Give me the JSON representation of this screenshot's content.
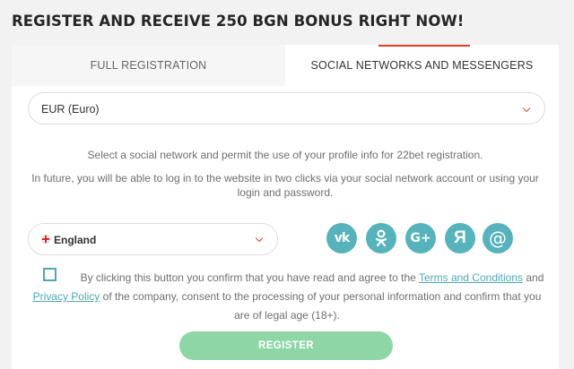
{
  "heading": "REGISTER AND RECEIVE 250 BGN BONUS RIGHT NOW!",
  "tabs": [
    {
      "label": "FULL REGISTRATION"
    },
    {
      "label": "SOCIAL NETWORKS AND MESSENGERS"
    }
  ],
  "active_tab": 1,
  "currency": {
    "value": "EUR (Euro)"
  },
  "info": {
    "line1": "Select a social network and permit the use of your profile info for 22bet registration.",
    "line2": "In future, you will be able to log in to the website in two clicks via your social network account or using your login and password."
  },
  "country": {
    "value": "England"
  },
  "social": [
    {
      "icon": "vk-icon",
      "glyph": "vk"
    },
    {
      "icon": "odnoklassniki-icon",
      "glyph": "ok"
    },
    {
      "icon": "google-plus-icon",
      "glyph": "G+"
    },
    {
      "icon": "yandex-icon",
      "glyph": "Я"
    },
    {
      "icon": "mail-at-icon",
      "glyph": "@"
    }
  ],
  "agreement": {
    "checked": false,
    "text_before": "By clicking this button you confirm that you have read and agree to the",
    "terms_link": "Terms and Conditions",
    "and": "and",
    "privacy_link": "Privacy Policy",
    "text_after": "of the company, consent to the processing of your personal information and confirm that you are of legal age (18+)."
  },
  "register_button": "REGISTER",
  "colors": {
    "accent_red": "#e63b2e",
    "teal": "#56b3bb",
    "register_green": "#8fd6a6"
  }
}
